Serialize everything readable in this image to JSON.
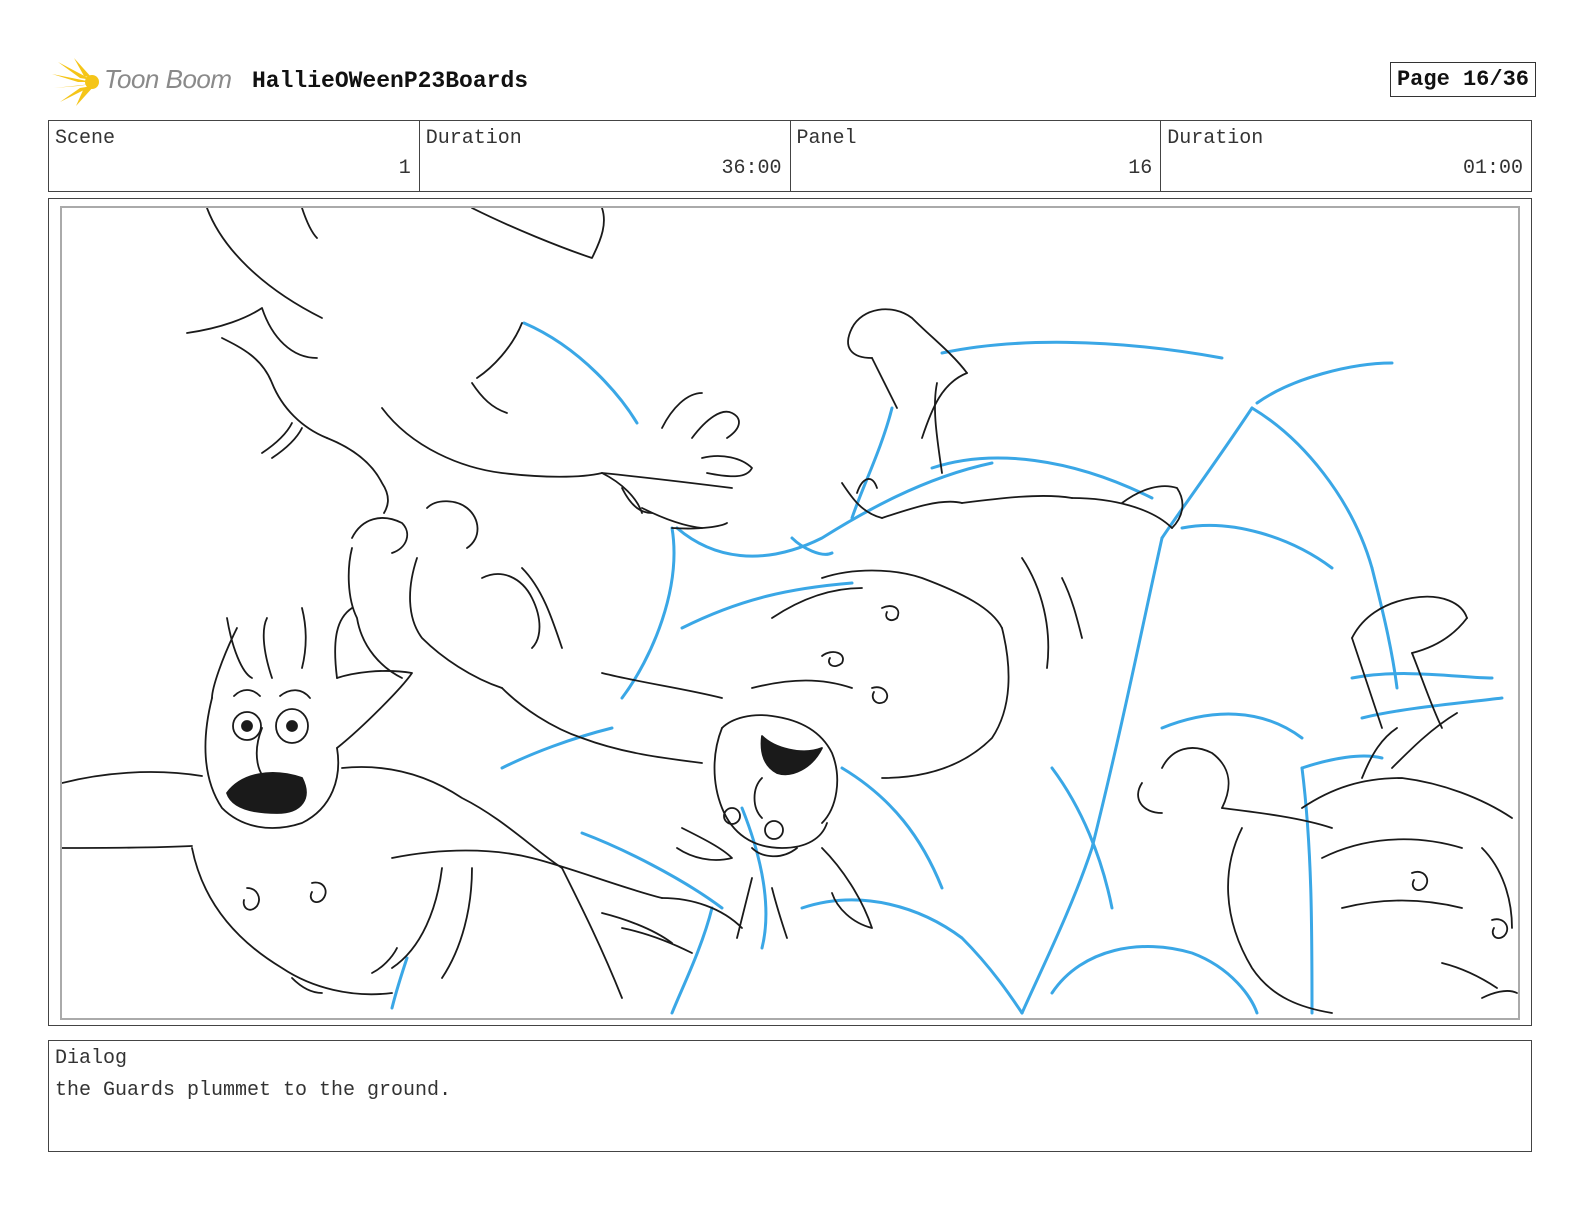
{
  "header": {
    "logo_text": "Toon Boom",
    "project_title": "HallieOWeenP23Boards",
    "page_label": "Page 16/36"
  },
  "info": {
    "scene_label": "Scene",
    "scene_value": "1",
    "scene_duration_label": "Duration",
    "scene_duration_value": "36:00",
    "panel_label": "Panel",
    "panel_value": "16",
    "panel_duration_label": "Duration",
    "panel_duration_value": "01:00"
  },
  "dialog": {
    "label": "Dialog",
    "text": "the Guards plummet to the ground."
  },
  "colors": {
    "logo_accent": "#f5c518",
    "sketch_line": "#1a1a1a",
    "guide_line": "#3aa7e6"
  },
  "icons": {
    "logo": "starburst-logo-icon"
  }
}
